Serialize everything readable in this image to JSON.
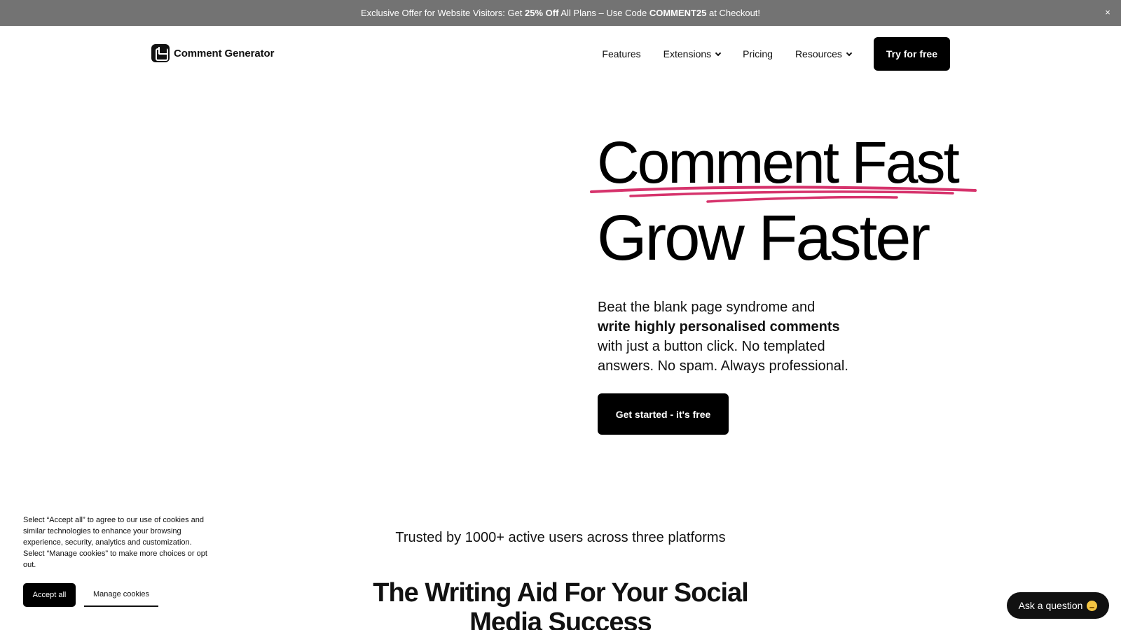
{
  "promo": {
    "prefix": "Exclusive Offer for Website Visitors: Get ",
    "discount": "25% Off",
    "middle": " All Plans – Use Code ",
    "code": "COMMENT25",
    "suffix": " at Checkout!",
    "close_label": "×"
  },
  "header": {
    "logo_text": "Comment Generator",
    "nav": {
      "features": "Features",
      "extensions": "Extensions",
      "pricing": "Pricing",
      "resources": "Resources"
    },
    "cta": "Try for free"
  },
  "hero": {
    "line1": "Comment Fast",
    "line2": "Grow Faster",
    "sub_1": "Beat the blank page syndrome and",
    "sub_bold": "write highly personalised comments",
    "sub_2": "with just a button click. No templated answers. No spam. Always professional.",
    "cta": "Get started - it's free"
  },
  "trusted": "Trusted by 1000+ active users across three platforms",
  "section_title": "The Writing Aid For Your Social Media Success",
  "cookie": {
    "text": "Select “Accept all” to agree to our use of cookies and similar technologies to enhance your browsing experience, security, analytics and customization. Select “Manage cookies” to make more choices or opt out.",
    "accept": "Accept all",
    "manage": "Manage cookies"
  },
  "chat": {
    "label": "Ask a question",
    "icon": "thinking-face-emoji"
  },
  "colors": {
    "accent_underline": "#d6336c",
    "promo_bg": "#737373",
    "button_bg": "#000000"
  }
}
